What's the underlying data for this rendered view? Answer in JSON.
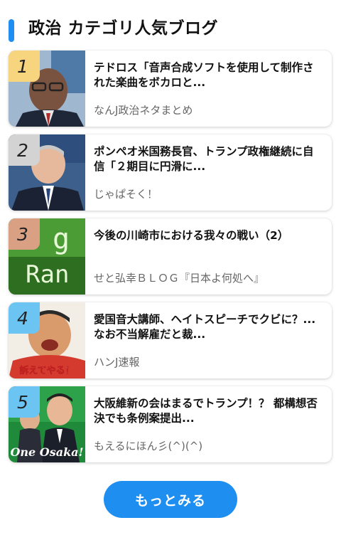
{
  "section": {
    "title": "政治 カテゴリ人気ブログ",
    "accent_color": "#1f8ef1"
  },
  "items": [
    {
      "rank": "1",
      "rank_color": "#f6d57e",
      "thumb_icon": "person-photo-icon",
      "title": "テドロス「音声合成ソフトを使用して制作された楽曲をボカロと...",
      "source": "なんJ政治ネタまとめ"
    },
    {
      "rank": "2",
      "rank_color": "#d3d3d3",
      "thumb_icon": "person-photo-icon",
      "title": "ポンペオ米国務長官、トランプ政権継続に自信「２期目に円滑に...",
      "source": "じゃぱそく！"
    },
    {
      "rank": "3",
      "rank_color": "#d9a083",
      "thumb_icon": "blog-ranking-banner-icon",
      "title": "今後の川崎市における我々の戦い（2）",
      "source": "せと弘幸ＢＬＯＧ『日本よ何処へ』",
      "thumb_text_1": "g",
      "thumb_text_2": "Ran"
    },
    {
      "rank": "4",
      "rank_color": "#6cc4f2",
      "thumb_icon": "person-photo-icon",
      "title": "愛国音大講師、ヘイトスピーチでクビに？...なお不当解雇だと裁...",
      "source": "ハンJ速報",
      "thumb_text": "訴えてやる！"
    },
    {
      "rank": "5",
      "rank_color": "#6cc4f2",
      "thumb_icon": "person-photo-icon",
      "title": "大阪維新の会はまるでトランプ！？ 都構想否決でも条例案提出...",
      "source": "もえるにほん彡(^)(^)",
      "thumb_text": "One Osaka!"
    }
  ],
  "more_button": {
    "label": "もっとみる"
  }
}
